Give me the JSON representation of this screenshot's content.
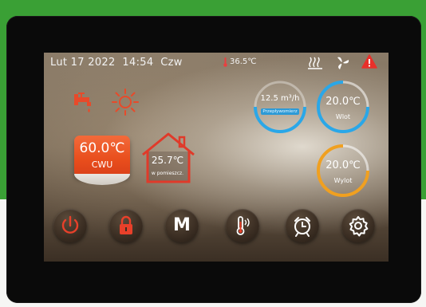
{
  "status": {
    "date": "Lut  17  2022",
    "time": "14:54",
    "weekday": "Czw",
    "outside_temp": "36.5℃"
  },
  "dhw": {
    "temp": "60.0℃",
    "label": "CWU"
  },
  "room": {
    "temp": "25.7℃",
    "label": "w pomieszcz."
  },
  "flow": {
    "value": "12.5 m³/h",
    "label": "Przepływomierz"
  },
  "inlet": {
    "temp": "20.0℃",
    "label": "Wlot"
  },
  "outlet": {
    "temp": "20.0℃",
    "label": "Wylot"
  },
  "buttons": {
    "mode_label": "M"
  },
  "icons": [
    "thermometer-icon",
    "heating-icon",
    "defrost-fan-icon",
    "alarm-warning-icon",
    "hot-water-tap-icon",
    "sun-icon",
    "house-icon",
    "power-icon",
    "lock-icon",
    "mode-icon",
    "temperature-curve-icon",
    "alarm-clock-icon",
    "settings-gear-icon"
  ],
  "colors": {
    "accent_red": "#e8401e",
    "gauge_blue": "#2aa7e8",
    "gauge_orange": "#f0a020"
  }
}
